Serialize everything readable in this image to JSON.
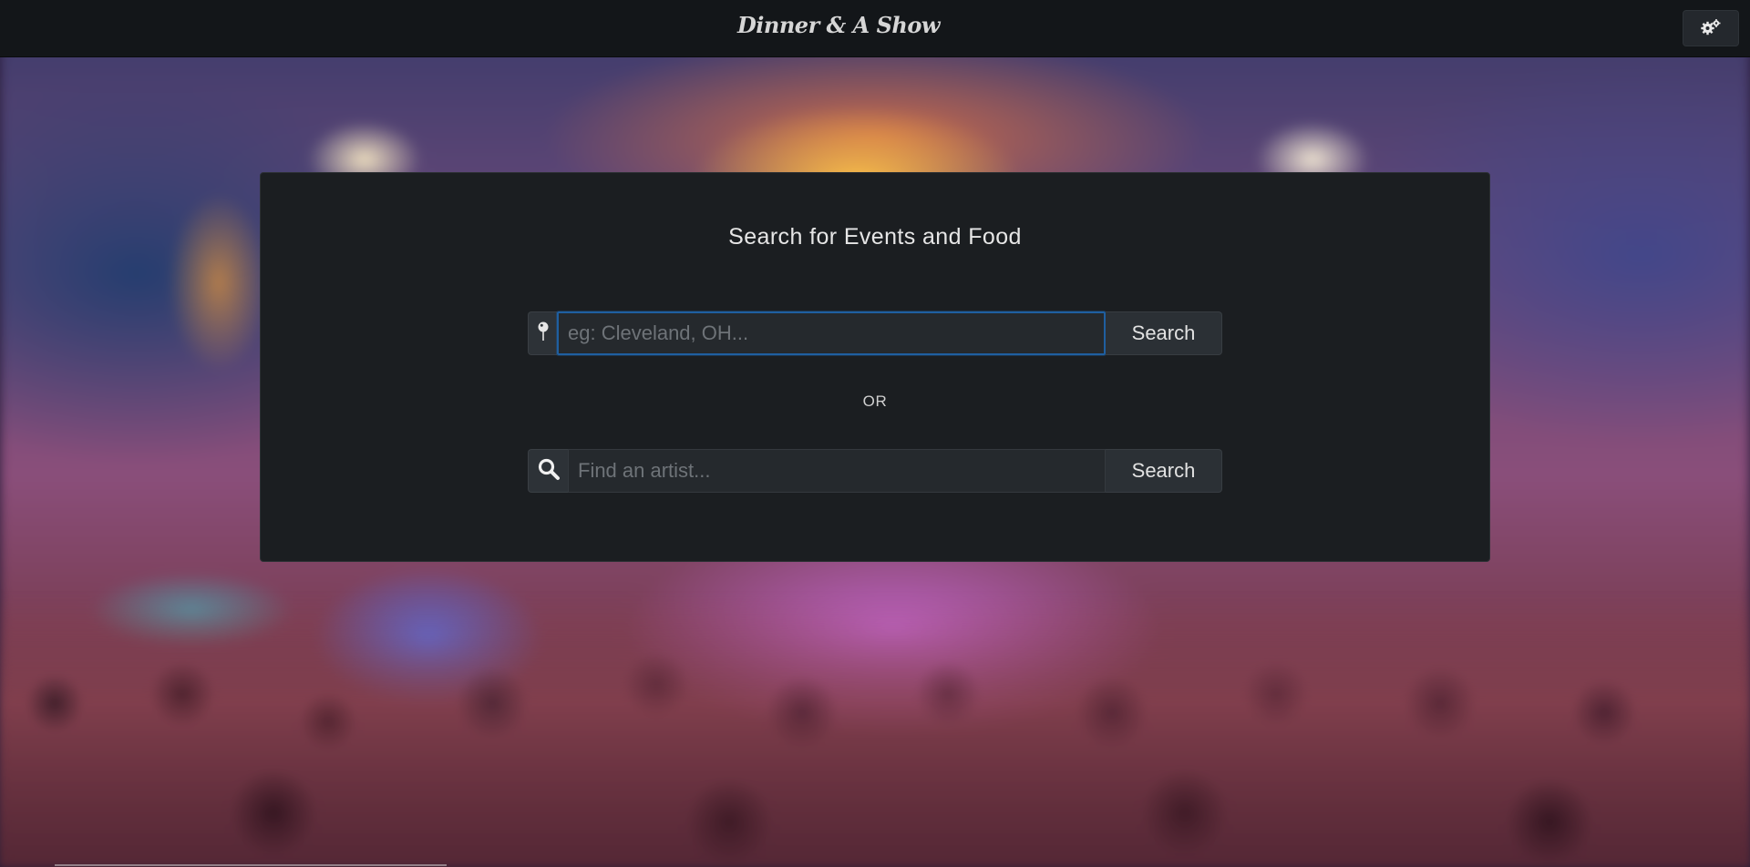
{
  "navbar": {
    "brand": "Dinner & A Show",
    "settings_icon": "gears-icon"
  },
  "panel": {
    "title": "Search for Events and Food",
    "or_label": "OR",
    "location_search": {
      "icon": "map-pin-icon",
      "placeholder": "eg: Cleveland, OH...",
      "value": "",
      "button_label": "Search"
    },
    "artist_search": {
      "icon": "search-icon",
      "placeholder": "Find an artist...",
      "value": "",
      "button_label": "Search"
    }
  },
  "colors": {
    "navbar_bg": "#131619",
    "panel_bg": "#1b1e21",
    "focus_border": "#1f5fa0"
  }
}
